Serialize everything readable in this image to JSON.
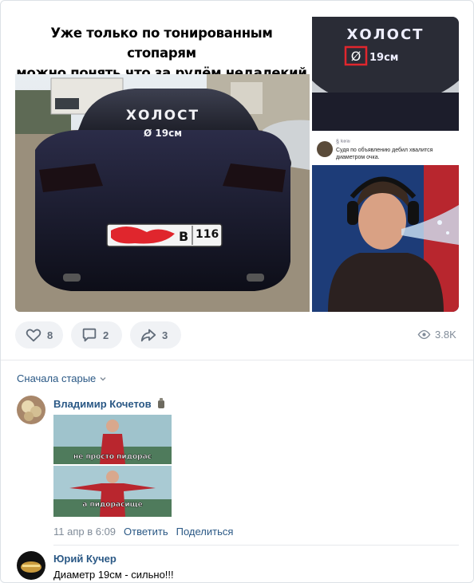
{
  "post": {
    "caption": "Уже только по тонированным стопарям\nможно понять,что за рулём недалекий",
    "rear_glass_text": "ХОЛОСТ",
    "diameter_text": "Ø 19см",
    "plate_region": "116",
    "plate_letter": "В",
    "zoom_text": "ХОЛОСТ",
    "zoom_diameter": "19см",
    "tweet_handle": "§ ᴵᵉᵃ⁽ᵃᶦ",
    "tweet_text": "Судя по объявлению дебил хвалится диаметром очка."
  },
  "actions": {
    "likes": "8",
    "comments": "2",
    "shares": "3",
    "views": "3.8K"
  },
  "sort_label": "Сначала старые",
  "comments": [
    {
      "author": "Владимир Кочетов",
      "meme_top": "не просто пидорас",
      "meme_bottom": "а пидорасище",
      "date": "11 апр в 6:09",
      "reply": "Ответить",
      "share": "Поделиться"
    },
    {
      "author": "Юрий Кучер",
      "text": "Диаметр 19см - сильно!!!"
    }
  ],
  "icons": [
    "heart-icon",
    "comment-icon",
    "share-icon",
    "eye-icon",
    "chevron-down-icon",
    "avatar-badge-icon"
  ],
  "colors": {
    "link": "#2a5885",
    "muted": "#818c99",
    "pill": "#f0f2f5",
    "highlight": "#e0262d"
  }
}
